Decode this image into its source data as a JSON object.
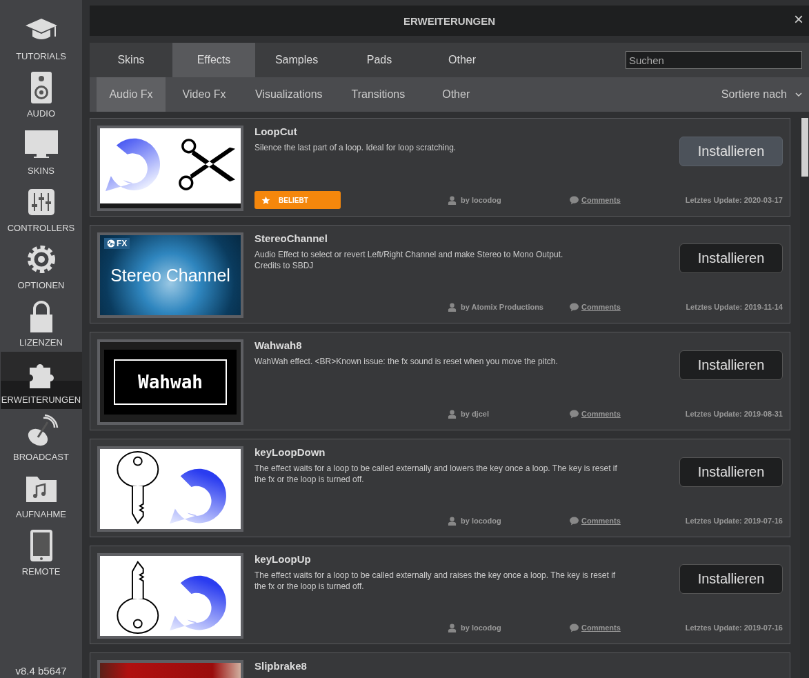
{
  "sidebar": {
    "items": [
      {
        "label": "TUTORIALS",
        "kind": "tutorials",
        "selected": false
      },
      {
        "label": "AUDIO",
        "kind": "audio",
        "selected": false
      },
      {
        "label": "SKINS",
        "kind": "skins",
        "selected": false
      },
      {
        "label": "CONTROLLERS",
        "kind": "controllers",
        "selected": false
      },
      {
        "label": "OPTIONEN",
        "kind": "options",
        "selected": false
      },
      {
        "label": "LIZENZEN",
        "kind": "licenses",
        "selected": false
      },
      {
        "label": "ERWEITERUNGEN",
        "kind": "extensions",
        "selected": true
      },
      {
        "label": "BROADCAST",
        "kind": "broadcast",
        "selected": false
      },
      {
        "label": "AUFNAHME",
        "kind": "recording",
        "selected": false
      },
      {
        "label": "REMOTE",
        "kind": "remote",
        "selected": false
      }
    ],
    "version": "v8.4 b5647"
  },
  "window": {
    "title": "ERWEITERUNGEN",
    "close": "×"
  },
  "tabs": [
    {
      "label": "Skins",
      "selected": false
    },
    {
      "label": "Effects",
      "selected": true
    },
    {
      "label": "Samples",
      "selected": false
    },
    {
      "label": "Pads",
      "selected": false
    },
    {
      "label": "Other",
      "selected": false
    }
  ],
  "search": {
    "placeholder": "Suchen"
  },
  "subtabs": [
    {
      "label": "Audio Fx",
      "selected": true
    },
    {
      "label": "Video Fx",
      "selected": false
    },
    {
      "label": "Visualizations",
      "selected": false
    },
    {
      "label": "Transitions",
      "selected": false
    },
    {
      "label": "Other",
      "selected": false
    }
  ],
  "sort": {
    "label": "Sortiere nach"
  },
  "extensions": [
    {
      "title": "LoopCut",
      "description": "Silence the last part of a loop. Ideal for loop scratching.",
      "thumbnail": {
        "kind": "loop-scissors"
      },
      "badge": "BELIEBT",
      "author": "by locodog",
      "comments": "Comments",
      "updated": "Letztes Update: 2020-03-17",
      "button": "Installieren",
      "hovered": true
    },
    {
      "title": "StereoChannel",
      "description": "Audio Effect to select or revert Left/Right Channel and make Stereo to Mono Output.\nCredits to SBDJ",
      "thumbnail": {
        "kind": "stereo",
        "tag": "FX",
        "text": "Stereo Channel"
      },
      "author": "by Atomix Productions",
      "comments": "Comments",
      "updated": "Letztes Update: 2019-11-14",
      "button": "Installieren",
      "hovered": false
    },
    {
      "title": "Wahwah8",
      "description": "WahWah effect. <BR>Known issue: the fx sound is reset when you move the pitch.",
      "thumbnail": {
        "kind": "wahwah",
        "text": "Wahwah"
      },
      "author": "by djcel",
      "comments": "Comments",
      "updated": "Letztes Update: 2019-08-31",
      "button": "Installieren",
      "hovered": false
    },
    {
      "title": "keyLoopDown",
      "description": "The effect waits for a loop to be called externally and lowers the key once a loop. The key is reset if the fx or the loop is turned off.",
      "thumbnail": {
        "kind": "key-down"
      },
      "author": "by locodog",
      "comments": "Comments",
      "updated": "Letztes Update: 2019-07-16",
      "button": "Installieren",
      "hovered": false
    },
    {
      "title": "keyLoopUp",
      "description": "The effect waits for a loop to be called externally and raises the key once a loop. The key is reset if the fx or the loop is turned off.",
      "thumbnail": {
        "kind": "key-up"
      },
      "author": "by locodog",
      "comments": "Comments",
      "updated": "Letztes Update: 2019-07-16",
      "button": "Installieren",
      "hovered": false
    },
    {
      "title": "Slipbrake8",
      "thumbnail": {
        "kind": "photo"
      }
    }
  ]
}
